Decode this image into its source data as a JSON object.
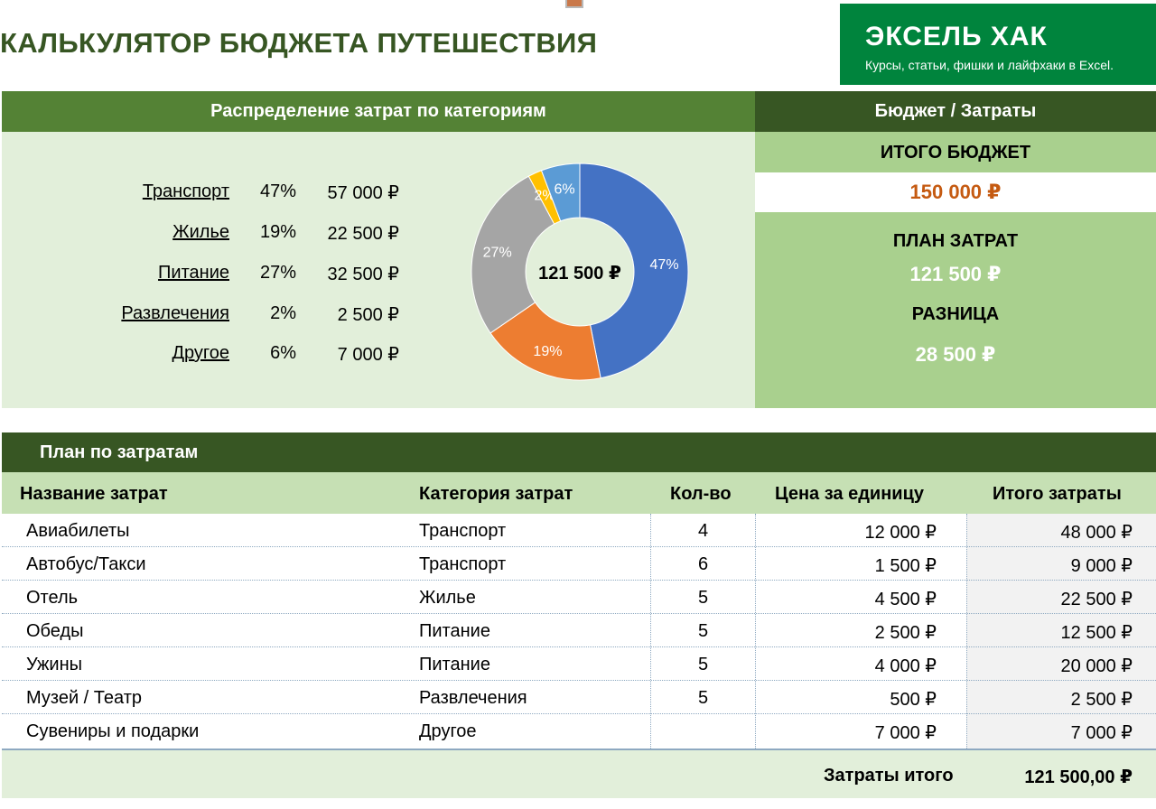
{
  "page_title": "КАЛЬКУЛЯТОР БЮДЖЕТА ПУТЕШЕСТВИЯ",
  "brand": {
    "name": "ЭКСЕЛЬ ХАК",
    "tagline": "Курсы, статьи, фишки и лайфхаки в Excel.",
    "color": "#00843d"
  },
  "category_section": {
    "header": "Распределение затрат по категориям",
    "rows": [
      {
        "name": "Транспорт",
        "percent": "47%",
        "amount": "57 000 ₽"
      },
      {
        "name": "Жилье",
        "percent": "19%",
        "amount": "22 500 ₽"
      },
      {
        "name": "Питание",
        "percent": "27%",
        "amount": "32 500 ₽"
      },
      {
        "name": "Развлечения",
        "percent": "2%",
        "amount": "2 500 ₽"
      },
      {
        "name": "Другое",
        "percent": "6%",
        "amount": "7 000 ₽"
      }
    ]
  },
  "chart_data": {
    "type": "pie",
    "variant": "donut",
    "center_label": "121 500 ₽",
    "categories": [
      "Транспорт",
      "Жилье",
      "Питание",
      "Развлечения",
      "Другое"
    ],
    "values": [
      57000,
      22500,
      32500,
      2500,
      7000
    ],
    "labels": [
      "47%",
      "19%",
      "27%",
      "2%",
      "6%"
    ],
    "colors": [
      "#4472c4",
      "#ed7d31",
      "#a5a5a5",
      "#ffc000",
      "#5b9bd5"
    ]
  },
  "budget_section": {
    "header": "Бюджет / Затраты",
    "total_budget_label": "ИТОГО БЮДЖЕТ",
    "total_budget_value": "150 000 ₽",
    "plan_label": "ПЛАН ЗАТРАТ",
    "plan_value": "121 500 ₽",
    "diff_label": "РАЗНИЦА",
    "diff_value": "28 500 ₽"
  },
  "plan_table": {
    "header": "План по затратам",
    "columns": [
      "Название затрат",
      "Категория затрат",
      "Кол-во",
      "Цена за единицу",
      "Итого затраты"
    ],
    "rows": [
      {
        "name": "Авиабилеты",
        "category": "Транспорт",
        "qty": "4",
        "price": "12 000 ₽",
        "total": "48 000 ₽"
      },
      {
        "name": "Автобус/Такси",
        "category": "Транспорт",
        "qty": "6",
        "price": "1 500 ₽",
        "total": "9 000 ₽"
      },
      {
        "name": "Отель",
        "category": "Жилье",
        "qty": "5",
        "price": "4 500 ₽",
        "total": "22 500 ₽"
      },
      {
        "name": "Обеды",
        "category": "Питание",
        "qty": "5",
        "price": "2 500 ₽",
        "total": "12 500 ₽"
      },
      {
        "name": "Ужины",
        "category": "Питание",
        "qty": "5",
        "price": "4 000 ₽",
        "total": "20 000 ₽"
      },
      {
        "name": "Музей / Театр",
        "category": "Развлечения",
        "qty": "5",
        "price": "500 ₽",
        "total": "2 500 ₽"
      },
      {
        "name": "Сувениры и подарки",
        "category": "Другое",
        "qty": "",
        "price": "7 000 ₽",
        "total": "7 000 ₽"
      }
    ],
    "footer_label": "Затраты итого",
    "footer_value": "121 500,00 ₽"
  }
}
